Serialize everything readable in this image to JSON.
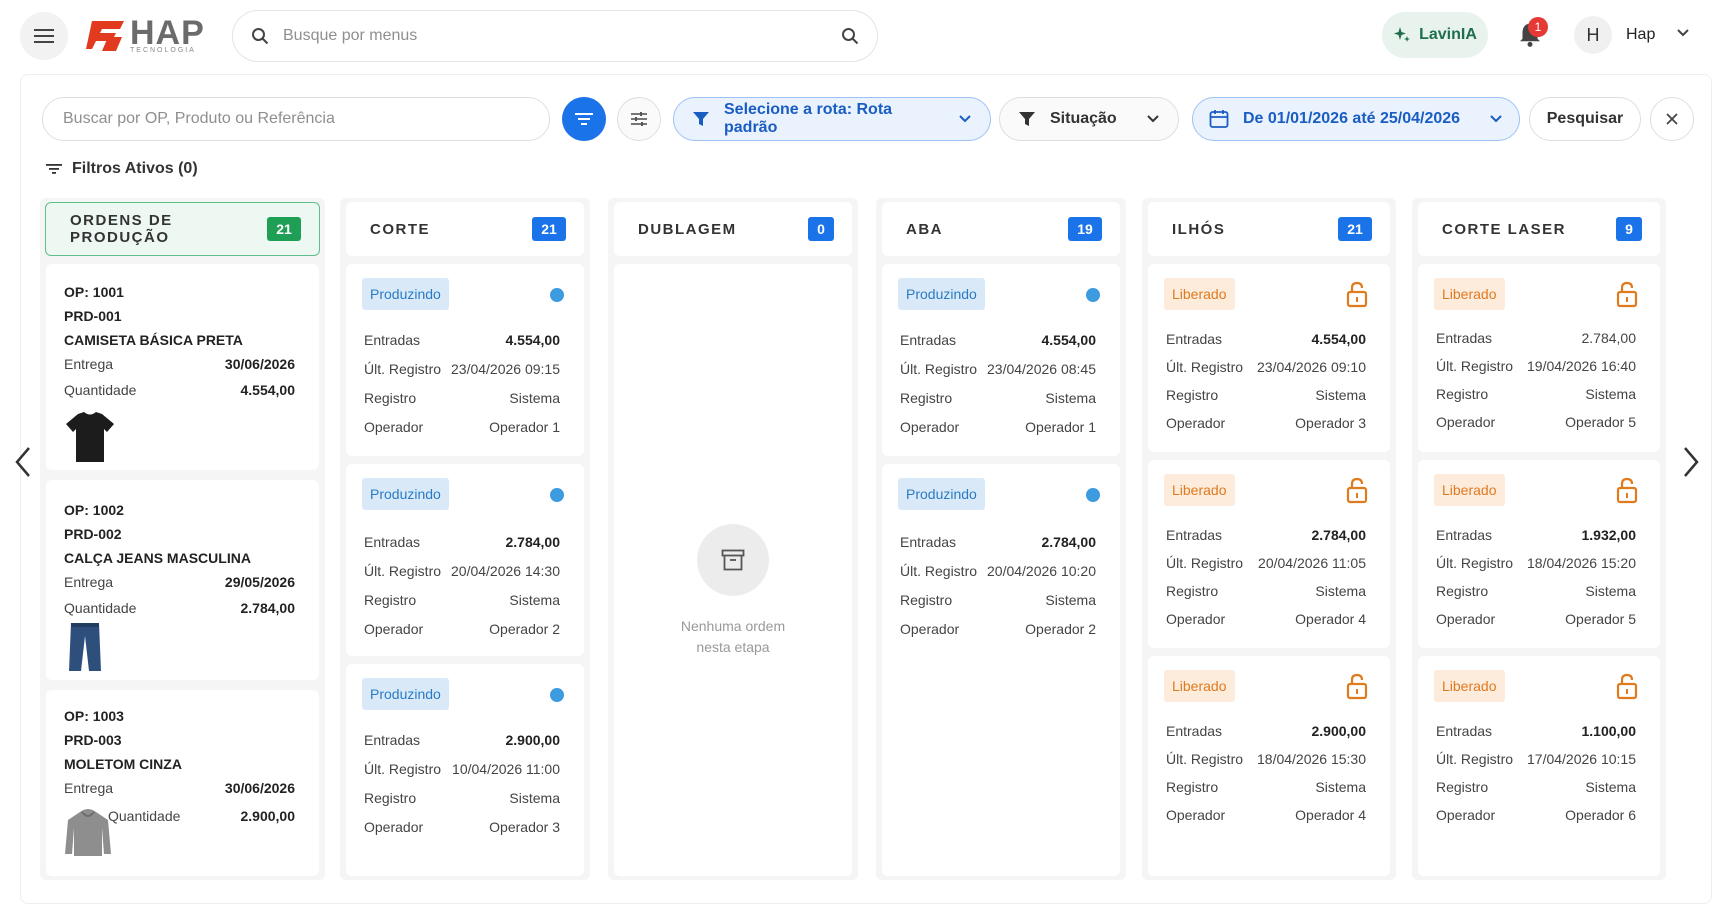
{
  "header": {
    "logo_text": "HAP",
    "logo_sub": "TECNOLOGIA",
    "search_placeholder": "Busque por menus",
    "assistant_label": "LavinIA",
    "notification_count": "1",
    "avatar_initial": "H",
    "user_name": "Hap"
  },
  "filters": {
    "op_search_placeholder": "Buscar por OP, Produto ou Referência",
    "route_label": "Selecione a rota: Rota padrão",
    "status_label": "Situação",
    "date_range_label": "De 01/01/2026 até 25/04/2026",
    "search_button": "Pesquisar",
    "active_filters": "Filtros Ativos (0)"
  },
  "labels": {
    "entradas": "Entradas",
    "ult_registro": "Últ. Registro",
    "registro": "Registro",
    "operador": "Operador",
    "entrega": "Entrega",
    "quantidade": "Quantidade"
  },
  "columns": {
    "orders": {
      "title": "ORDENS DE PRODUÇÃO",
      "count": "21",
      "cards": [
        {
          "op": "OP: 1001",
          "ref": "PRD-001",
          "product": "CAMISETA BÁSICA PRETA",
          "entrega": "30/06/2026",
          "quantidade": "4.554,00",
          "image": "black-tshirt"
        },
        {
          "op": "OP: 1002",
          "ref": "PRD-002",
          "product": "CALÇA JEANS MASCULINA",
          "entrega": "29/05/2026",
          "quantidade": "2.784,00",
          "image": "jeans"
        },
        {
          "op": "OP: 1003",
          "ref": "PRD-003",
          "product": "MOLETOM CINZA",
          "entrega": "30/06/2026",
          "quantidade": "2.900,00",
          "image": "grey-hoodie"
        }
      ]
    },
    "corte": {
      "title": "CORTE",
      "count": "21",
      "cards": [
        {
          "status": "Produzindo",
          "entradas": "4.554,00",
          "ult_registro": "23/04/2026 09:15",
          "registro": "Sistema",
          "operador": "Operador 1"
        },
        {
          "status": "Produzindo",
          "entradas": "2.784,00",
          "ult_registro": "20/04/2026 14:30",
          "registro": "Sistema",
          "operador": "Operador 2"
        },
        {
          "status": "Produzindo",
          "entradas": "2.900,00",
          "ult_registro": "10/04/2026 11:00",
          "registro": "Sistema",
          "operador": "Operador 3"
        }
      ]
    },
    "dublagem": {
      "title": "DUBLAGEM",
      "count": "0",
      "empty_text": "Nenhuma ordem nesta etapa"
    },
    "aba": {
      "title": "ABA",
      "count": "19",
      "cards": [
        {
          "status": "Produzindo",
          "entradas": "4.554,00",
          "ult_registro": "23/04/2026 08:45",
          "registro": "Sistema",
          "operador": "Operador 1"
        },
        {
          "status": "Produzindo",
          "entradas": "2.784,00",
          "ult_registro": "20/04/2026 10:20",
          "registro": "Sistema",
          "operador": "Operador 2"
        }
      ]
    },
    "ilhos": {
      "title": "ILHÓS",
      "count": "21",
      "cards": [
        {
          "status": "Liberado",
          "entradas": "4.554,00",
          "ult_registro": "23/04/2026 09:10",
          "registro": "Sistema",
          "operador": "Operador 3"
        },
        {
          "status": "Liberado",
          "entradas": "2.784,00",
          "ult_registro": "20/04/2026 11:05",
          "registro": "Sistema",
          "operador": "Operador 4"
        },
        {
          "status": "Liberado",
          "entradas": "2.900,00",
          "ult_registro": "18/04/2026 15:30",
          "registro": "Sistema",
          "operador": "Operador 4"
        }
      ]
    },
    "corte_laser": {
      "title": "CORTE LASER",
      "count": "9",
      "cards": [
        {
          "status": "Liberado",
          "entradas": "2.784,00",
          "ult_registro": "19/04/2026 16:40",
          "registro": "Sistema",
          "operador": "Operador 5"
        },
        {
          "status": "Liberado",
          "entradas": "1.932,00",
          "ult_registro": "18/04/2026 15:20",
          "registro": "Sistema",
          "operador": "Operador 5"
        },
        {
          "status": "Liberado",
          "entradas": "1.100,00",
          "ult_registro": "17/04/2026 10:15",
          "registro": "Sistema",
          "operador": "Operador 6"
        }
      ]
    }
  },
  "colors": {
    "primary": "#1a73e8",
    "success": "#1f9e55",
    "produzindo": "#2a7bc4",
    "liberado": "#e07a1f"
  }
}
